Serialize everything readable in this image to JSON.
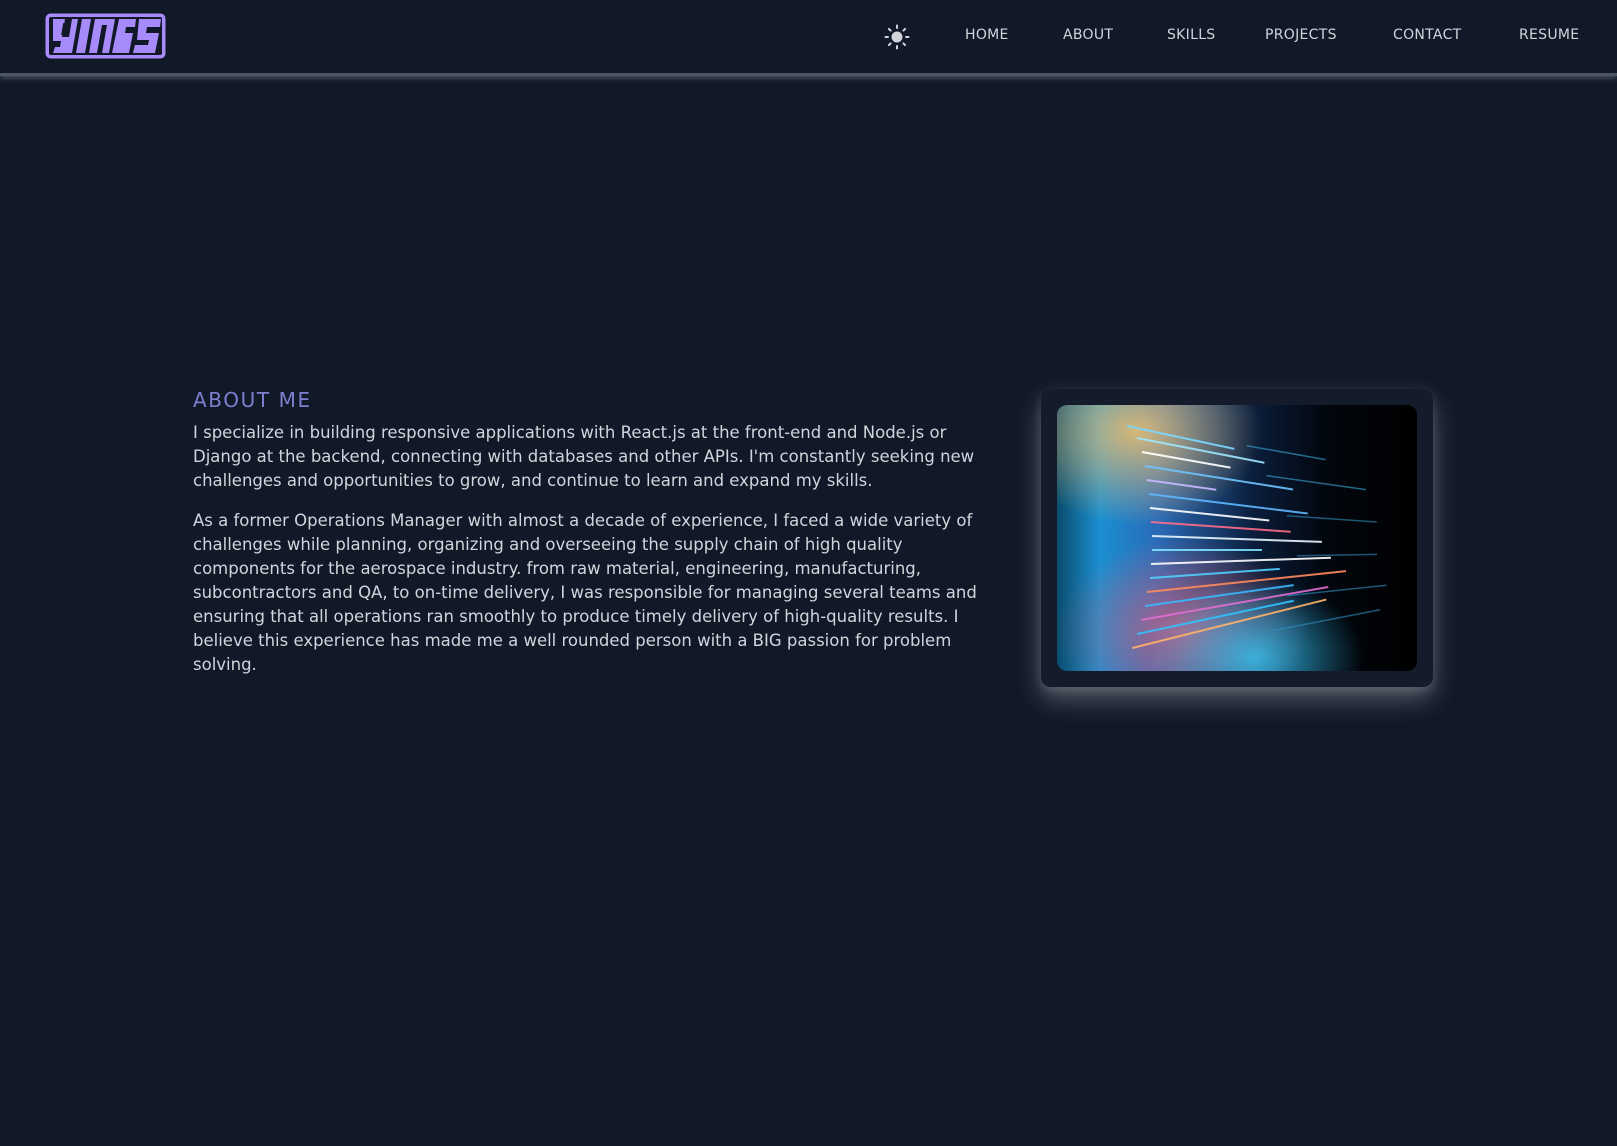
{
  "navbar": {
    "logo_icon": "monogram-logo-icon",
    "theme_toggle_icon": "sun-icon",
    "links": [
      {
        "label": "HOME"
      },
      {
        "label": "ABOUT"
      },
      {
        "label": "SKILLS"
      },
      {
        "label": "PROJECTS"
      },
      {
        "label": "CONTACT"
      },
      {
        "label": "RESUME"
      }
    ]
  },
  "about": {
    "heading": "ABOUT ME",
    "paragraphs": [
      "I specialize in building responsive applications with React.js at the front-end and Node.js or Django at the backend, connecting with databases and other APIs. I'm constantly seeking new challenges and opportunities to grow, and continue to learn and expand my skills.",
      "As a former Operations Manager with almost a decade of experience, I faced a wide variety of challenges while planning, organizing and overseeing the supply chain of high quality components for the aerospace industry. from raw material, engineering, manufacturing, subcontractors and QA, to on-time delivery, I was responsible for managing several teams and ensuring that all operations ran smoothly to produce timely delivery of high-quality results. I believe this experience has made me a well rounded person with a BIG passion for problem solving."
    ],
    "image_subject": "code-on-screen-image"
  },
  "colors": {
    "background": "#111827",
    "text": "#d1d5db",
    "accent_heading": "#7c7fcf",
    "logo": "#a78bfa",
    "navbar_border": "#4b5563"
  }
}
